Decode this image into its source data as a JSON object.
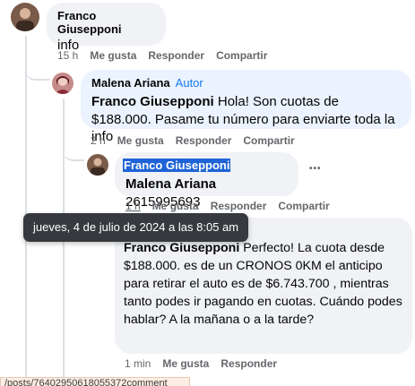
{
  "comments": {
    "c1": {
      "author": "Franco Giusepponi",
      "text": "info",
      "time": "15 h",
      "like": "Me gusta",
      "reply": "Responder",
      "share": "Compartir"
    },
    "c2": {
      "author": "Malena Ariana",
      "tag": "Autor",
      "mention": "Franco Giusepponi",
      "text": " Hola! Son cuotas de $188.000. Pasame tu número para enviarte toda la info",
      "time": "2 h",
      "like": "Me gusta",
      "reply": "Responder",
      "share": "Compartir"
    },
    "c3": {
      "author": "Franco Giusepponi",
      "mention": "Malena Ariana",
      "text": " 2615995693",
      "time": "1 h",
      "like": "Me gusta",
      "reply": "Responder",
      "share": "Compartir",
      "more": "•••"
    },
    "c4": {
      "mention": "Franco Giusepponi",
      "text": " Perfecto! La cuota desde $188.000. es de un CRONOS 0KM el anticipo para retirar el auto es de $6.743.700 , mientras tanto podes ir pagando en cuotas. Cuándo podes hablar? A la mañana o a la tarde?",
      "time": "1 min",
      "like": "Me gusta",
      "reply": "Responder"
    }
  },
  "tooltip": "jueves, 4 de julio de 2024 a las 8:05 am",
  "status_url": "/posts/76402950618055372comment",
  "colors": {
    "accent": "#1877f2",
    "tooltip_bg": "#363a3e",
    "bubble_gray": "#f0f2f5",
    "bubble_blue": "#eaf3ff"
  }
}
